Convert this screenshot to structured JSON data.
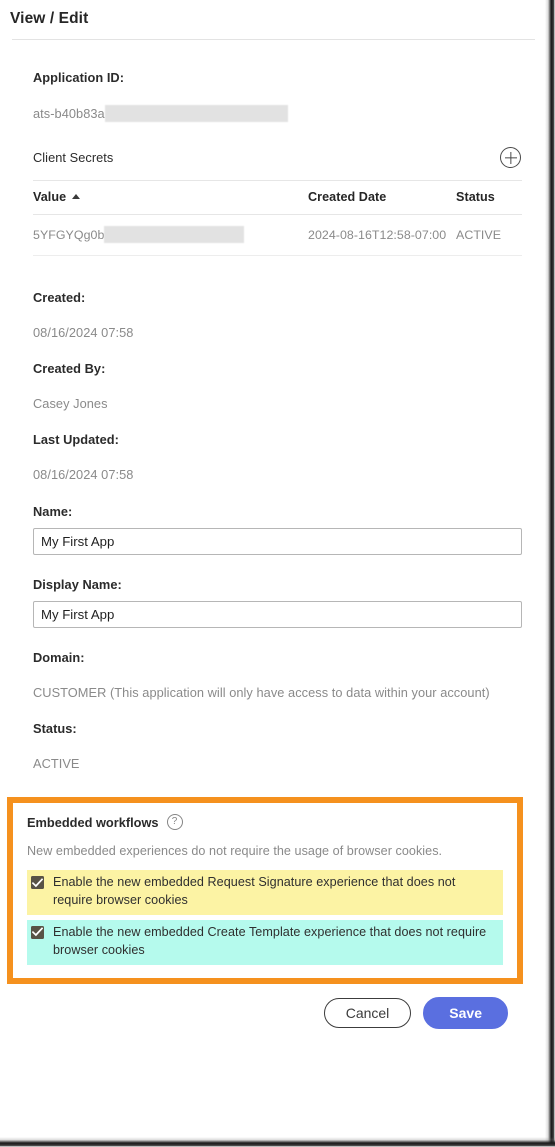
{
  "header": {
    "title": "View / Edit"
  },
  "application": {
    "app_id_label": "Application ID:",
    "app_id_value": "ats-b40b83a",
    "app_id_redacted": true
  },
  "client_secrets": {
    "title": "Client Secrets",
    "add_icon": "plus-circle-icon",
    "columns": [
      "Value",
      "Created Date",
      "Status"
    ],
    "sort_column": "Value",
    "sort_direction": "asc",
    "rows": [
      {
        "value": "5YFGYQg0b",
        "value_redacted": true,
        "created_date": "2024-08-16T12:58-07:00",
        "status": "ACTIVE"
      }
    ]
  },
  "meta": {
    "created_label": "Created:",
    "created_value": "08/16/2024 07:58",
    "created_by_label": "Created By:",
    "created_by_value": "Casey Jones",
    "last_updated_label": "Last Updated:",
    "last_updated_value": "08/16/2024 07:58"
  },
  "form": {
    "name_label": "Name:",
    "name_value": "My First App",
    "name_placeholder": "Name",
    "display_name_label": "Display Name:",
    "display_name_value": "My First App",
    "display_name_placeholder": "Display Name",
    "domain_label": "Domain:",
    "domain_value": "CUSTOMER (This application will only have access to data within your account)",
    "status_label": "Status:",
    "status_value": "ACTIVE"
  },
  "embedded_workflows": {
    "title": "Embedded workflows",
    "help_icon": "question-circle-icon",
    "help_glyph": "?",
    "description": "New embedded experiences do not require the usage of browser cookies.",
    "checkboxes": [
      {
        "label": "Enable the new embedded Request Signature experience that does not require browser cookies",
        "checked": true,
        "highlight": "#fcf3a4"
      },
      {
        "label": "Enable the new embedded Create Template experience that does not require browser cookies",
        "checked": true,
        "highlight": "#b5faed"
      }
    ],
    "callout_border_color": "#f5911e"
  },
  "footer": {
    "cancel_label": "Cancel",
    "save_label": "Save",
    "save_color": "#5a6fe0"
  }
}
